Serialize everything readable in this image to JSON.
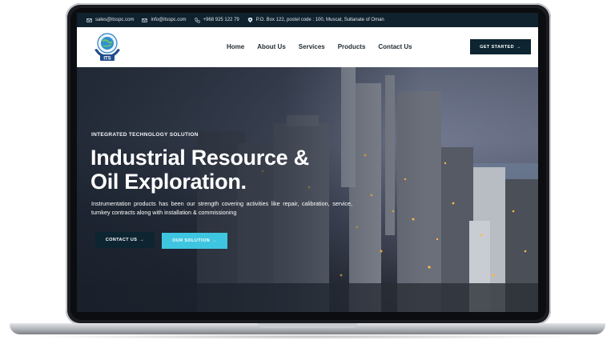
{
  "topbar": {
    "email_sales": "sales@itsspc.com",
    "email_info": "info@itsspc.com",
    "phone": "+968 925 122 79",
    "address": "P.O. Box 122, postel code : 100, Muscat, Sultanate of Oman",
    "icons": [
      "mail-icon",
      "mail-icon",
      "phone-icon",
      "location-pin-icon"
    ]
  },
  "logo": {
    "text": "ITS"
  },
  "nav": {
    "items": [
      "Home",
      "About Us",
      "Services",
      "Products",
      "Contact Us"
    ],
    "cta": "GET STARTED",
    "cta_arrow": "→"
  },
  "hero": {
    "eyebrow": "INTEGRATED TECHNOLOGY SOLUTION",
    "headline_line1": "Industrial Resource &",
    "headline_line2": "Oil Exploration.",
    "description": "Instrumentation products has been our strength covering activities like repair, calibration, service, turnkey contracts along with installation & commissioning",
    "button_primary": "CONTACT US",
    "button_secondary": "OUR SOLUTION",
    "arrow": "→"
  },
  "colors": {
    "dark_navy": "#0d2531",
    "topbar_bg": "#10222e",
    "accent_cyan": "#3ec6e0",
    "white": "#ffffff"
  }
}
